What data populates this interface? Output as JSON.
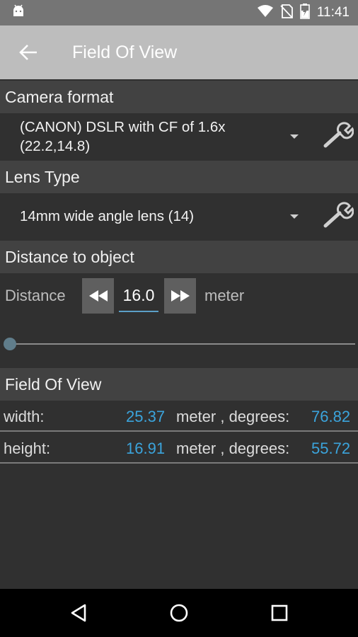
{
  "status_bar": {
    "time": "11:41"
  },
  "toolbar": {
    "title": "Field Of View"
  },
  "sections": {
    "camera_format": "Camera format",
    "lens_type": "Lens Type",
    "distance": "Distance to object",
    "fov": "Field Of View"
  },
  "camera_spinner": {
    "line1": "(CANON) DSLR with CF of 1.6x",
    "line2": "(22.2,14.8)"
  },
  "lens_spinner": {
    "value": "14mm wide angle lens (14)"
  },
  "distance_row": {
    "label": "Distance",
    "value": "16.0",
    "unit": "meter"
  },
  "slider": {
    "level": 0.0
  },
  "results": {
    "width": {
      "label": "width:",
      "meters": "25.37",
      "middle": "meter , degrees:",
      "degrees": "76.82"
    },
    "height": {
      "label": "height:",
      "meters": "16.91",
      "middle": "meter , degrees:",
      "degrees": "55.72"
    }
  },
  "colors": {
    "accent": "#3ba4dc",
    "toolbar": "#bdbdbd",
    "header": "#424242",
    "background": "#303030"
  }
}
